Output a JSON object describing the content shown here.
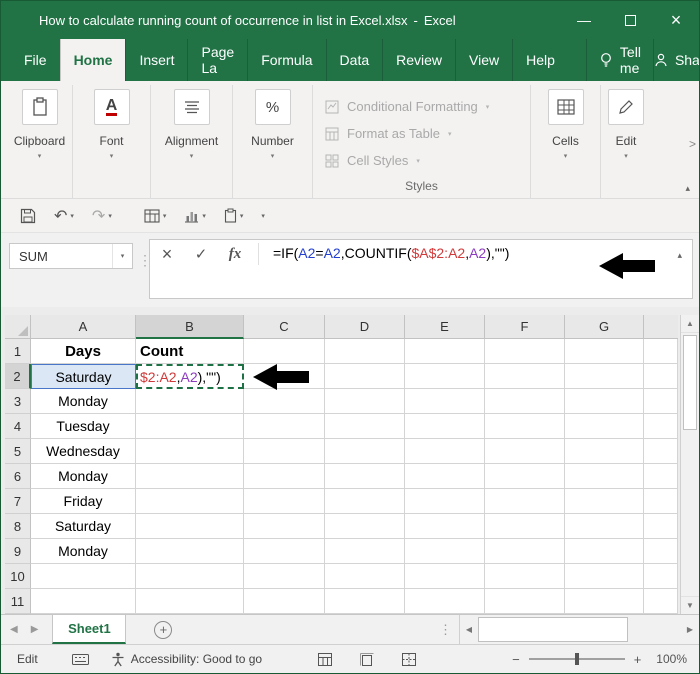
{
  "title_bar": {
    "title": "How to calculate running count of occurrence in list in Excel.xlsx",
    "separator": "-",
    "app": "Excel"
  },
  "ribbon": {
    "tabs": [
      {
        "label": "File"
      },
      {
        "label": "Home",
        "active": true
      },
      {
        "label": "Insert"
      },
      {
        "label": "Page La"
      },
      {
        "label": "Formula"
      },
      {
        "label": "Data"
      },
      {
        "label": "Review"
      },
      {
        "label": "View"
      },
      {
        "label": "Help"
      }
    ],
    "tell_me": "Tell me",
    "share": "Share",
    "groups": [
      {
        "label": "Clipboard"
      },
      {
        "label": "Font"
      },
      {
        "label": "Alignment"
      },
      {
        "label": "Number"
      },
      {
        "label": "Cells"
      },
      {
        "label": "Edit"
      }
    ],
    "styles_items": [
      {
        "label": "Conditional Formatting"
      },
      {
        "label": "Format as Table"
      },
      {
        "label": "Cell Styles"
      }
    ],
    "styles_label": "Styles",
    "more_indicator": ">"
  },
  "formula_bar": {
    "name_box": "SUM",
    "fx": "fx",
    "segments": [
      {
        "text": "=IF(",
        "color": "#000000"
      },
      {
        "text": "A2",
        "color": "#2440d0"
      },
      {
        "text": "=",
        "color": "#000000"
      },
      {
        "text": "A2",
        "color": "#2440d0"
      },
      {
        "text": ",COUNTIF(",
        "color": "#000000"
      },
      {
        "text": "$A$2:A2",
        "color": "#d03a3a"
      },
      {
        "text": ",",
        "color": "#000000"
      },
      {
        "text": "A2",
        "color": "#8d3bbf"
      },
      {
        "text": "),\"\")",
        "color": "#000000"
      }
    ]
  },
  "sheet": {
    "columns": [
      {
        "label": "A"
      },
      {
        "label": "B"
      },
      {
        "label": "C"
      },
      {
        "label": "D"
      },
      {
        "label": "E"
      },
      {
        "label": "F"
      },
      {
        "label": "G"
      }
    ],
    "rows": [
      {
        "n": "1",
        "A": "Days",
        "B": "Count"
      },
      {
        "n": "2",
        "A": "Saturday"
      },
      {
        "n": "3",
        "A": "Monday"
      },
      {
        "n": "4",
        "A": "Tuesday"
      },
      {
        "n": "5",
        "A": "Wednesday"
      },
      {
        "n": "6",
        "A": "Monday"
      },
      {
        "n": "7",
        "A": "Friday"
      },
      {
        "n": "8",
        "A": "Saturday"
      },
      {
        "n": "9",
        "A": "Monday"
      },
      {
        "n": "10"
      },
      {
        "n": "11"
      }
    ],
    "b2_segments": [
      {
        "text": "$2:A2",
        "color": "#d03a3a"
      },
      {
        "text": ",",
        "color": "#000000"
      },
      {
        "text": "A2",
        "color": "#8d3bbf"
      },
      {
        "text": "),\"\")",
        "color": "#000000"
      }
    ],
    "tab": "Sheet1"
  },
  "status_bar": {
    "mode": "Edit",
    "accessibility": "Accessibility: Good to go",
    "zoom": "100%"
  },
  "glyphs": {
    "window_min": "—",
    "window_close": "×",
    "dropdown": "▾",
    "collapse_up": "▴",
    "dots_v": "⋮",
    "undo": "↶",
    "redo": "↷",
    "cancel": "×",
    "check": "✓",
    "scroll_left": "◀",
    "scroll_right": "▶",
    "scroll_up": "▲",
    "scroll_down": "▼",
    "minus": "−",
    "plus": "+",
    "add_sheet": "+",
    "percent": "%",
    "font_letter": "A"
  },
  "colors": {
    "excel_green": "#217346",
    "reference_fill": "#dbe7f5",
    "reference_border": "#4a76c9",
    "edit_cell_border": "#1e7145"
  }
}
